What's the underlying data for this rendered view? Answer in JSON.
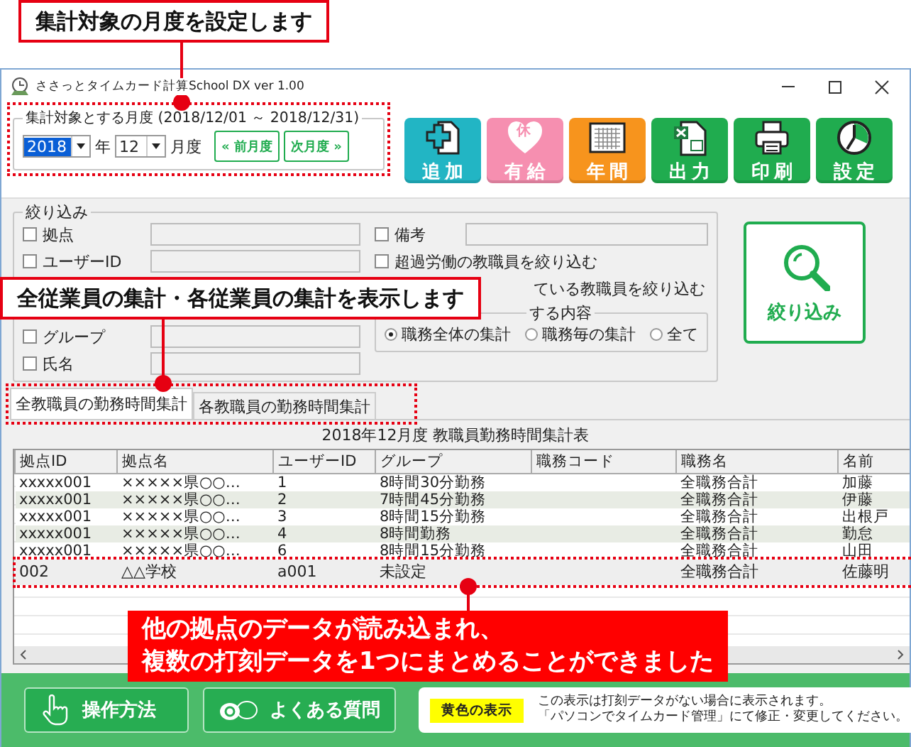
{
  "callouts": [
    {
      "kind": "box",
      "lines": [
        "集計対象の月度を設定します"
      ]
    },
    {
      "kind": "box",
      "lines": [
        "全従業員の集計・各従業員の集計を表示します"
      ]
    },
    {
      "kind": "filled",
      "lines": [
        "他の拠点のデータが読み込まれ、",
        "複数の打刻データを1つにまとめることができました"
      ]
    }
  ],
  "window": {
    "title": "ささっとタイムカード計算School DX  ver 1.00"
  },
  "month": {
    "legend": "集計対象とする月度 (2018/12/01 ～ 2018/12/31)",
    "year": "2018",
    "year_label": "年",
    "month": "12",
    "month_label": "月度",
    "prev": "« 前月度",
    "next": "次月度 »"
  },
  "toolbar": [
    {
      "label": "追加",
      "kind": "add",
      "color": "#22b5c4"
    },
    {
      "label": "有給",
      "kind": "leave",
      "color": "#f68fb0",
      "badge": "休"
    },
    {
      "label": "年間",
      "kind": "year",
      "color": "#f7941d"
    },
    {
      "label": "出力",
      "kind": "output",
      "color": "#20ac4f"
    },
    {
      "label": "印刷",
      "kind": "print",
      "color": "#20ac4f"
    },
    {
      "label": "設定",
      "kind": "settings",
      "color": "#20ac4f"
    }
  ],
  "filter": {
    "title": "絞り込み",
    "fields": [
      {
        "label": "拠点",
        "checked": false
      },
      {
        "label": "ユーザーID",
        "checked": false
      },
      {
        "label": "グループ",
        "checked": false
      },
      {
        "label": "氏名",
        "checked": false
      }
    ],
    "remarks": {
      "label": "備考",
      "checked": false
    },
    "options": [
      {
        "kind": "check",
        "label": "超過労働の教職員を絞り込む",
        "checked": false
      },
      {
        "kind": "text",
        "label": "ている教職員を絞り込む"
      }
    ],
    "group_title": "する内容",
    "radios": [
      {
        "label": "職務全体の集計",
        "selected": true
      },
      {
        "label": "職務毎の集計",
        "selected": false
      },
      {
        "label": "全て",
        "selected": false
      }
    ],
    "button": "絞り込み"
  },
  "tabs": [
    {
      "label": "全教職員の勤務時間集計",
      "selected": true
    },
    {
      "label": "各教職員の勤務時間集計",
      "selected": false
    }
  ],
  "table": {
    "caption": "2018年12月度 教職員勤務時間集計表",
    "columns": [
      "拠点ID",
      "拠点名",
      "ユーザーID",
      "グループ",
      "職務コード",
      "職務名",
      "名前"
    ],
    "rows": [
      {
        "kind": "normal",
        "cells": [
          "xxxxx001",
          "×××××県○○…",
          "1",
          "8時間30分勤務",
          "",
          "全職務合計",
          "加藤"
        ]
      },
      {
        "kind": "normal",
        "cells": [
          "xxxxx001",
          "×××××県○○…",
          "2",
          "7時間45分勤務",
          "",
          "全職務合計",
          "伊藤"
        ]
      },
      {
        "kind": "normal",
        "cells": [
          "xxxxx001",
          "×××××県○○…",
          "3",
          "8時間15分勤務",
          "",
          "全職務合計",
          "出根戸"
        ]
      },
      {
        "kind": "normal",
        "cells": [
          "xxxxx001",
          "×××××県○○…",
          "4",
          "8時間勤務",
          "",
          "全職務合計",
          "勤怠"
        ]
      },
      {
        "kind": "normal",
        "cells": [
          "xxxxx001",
          "×××××県○○…",
          "6",
          "8時間15分勤務",
          "",
          "全職務合計",
          "山田"
        ]
      },
      {
        "kind": "added",
        "cells": [
          "002",
          "△△学校",
          "a001",
          "未設定",
          "",
          "全職務合計",
          "佐藤明"
        ]
      }
    ]
  },
  "footer": {
    "buttons": [
      {
        "label": "操作方法",
        "kind": "hand"
      },
      {
        "label": "よくある質問",
        "kind": "qa"
      }
    ],
    "legend": "黄色の表示",
    "notes": [
      "この表示は打刻データがない場合に表示されます。",
      "「パソコンでタイムカード管理」にて修正・変更してください。"
    ]
  }
}
